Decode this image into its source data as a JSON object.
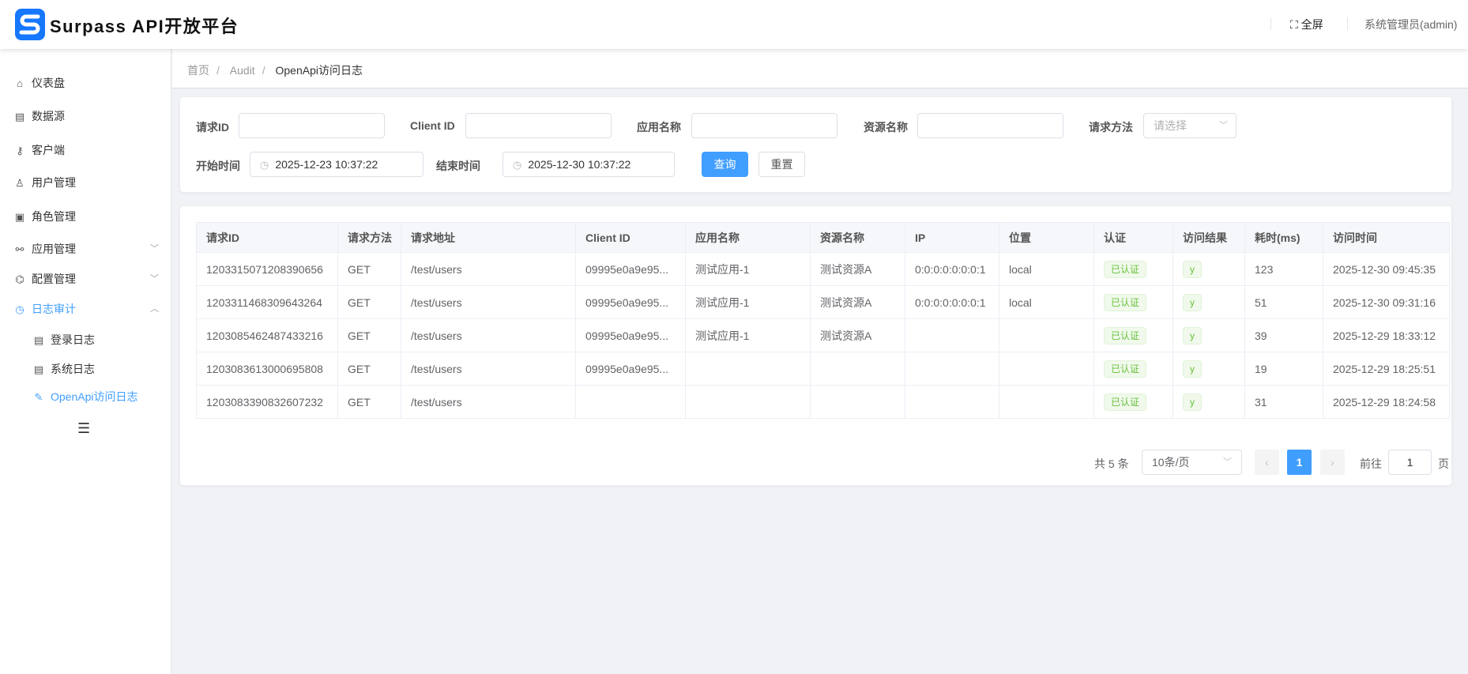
{
  "header": {
    "title": "Surpass API开放平台",
    "fullscreen_label": "全屏",
    "user_label": "系统管理员(admin)"
  },
  "sidebar": {
    "items": [
      {
        "label": "仪表盘",
        "icon": "home-icon",
        "glyph": "⌂"
      },
      {
        "label": "数据源",
        "icon": "database-icon",
        "glyph": "▤"
      },
      {
        "label": "客户端",
        "icon": "key-icon",
        "glyph": "⚷"
      },
      {
        "label": "用户管理",
        "icon": "user-icon",
        "glyph": "♙"
      },
      {
        "label": "角色管理",
        "icon": "role-icon",
        "glyph": "▣"
      },
      {
        "label": "应用管理",
        "icon": "app-icon",
        "glyph": "⚯",
        "chevron": "﹀"
      },
      {
        "label": "配置管理",
        "icon": "settings-icon",
        "glyph": "⌬",
        "chevron": "﹀"
      },
      {
        "label": "日志审计",
        "icon": "clock-icon",
        "glyph": "◷",
        "chevron": "︿",
        "active": true
      }
    ],
    "sub_items": [
      {
        "label": "登录日志",
        "icon": "log-icon",
        "glyph": "▤"
      },
      {
        "label": "系统日志",
        "icon": "log-icon",
        "glyph": "▤"
      },
      {
        "label": "OpenApi访问日志",
        "icon": "edit-icon",
        "glyph": "✎",
        "active": true
      }
    ]
  },
  "breadcrumb": [
    "首页",
    "Audit",
    "OpenApi访问日志"
  ],
  "filters": {
    "request_id_label": "请求ID",
    "request_id_value": "",
    "client_id_label": "Client ID",
    "client_id_value": "",
    "app_name_label": "应用名称",
    "app_name_value": "",
    "resource_name_label": "资源名称",
    "resource_name_value": "",
    "method_label": "请求方法",
    "method_placeholder": "请选择",
    "start_label": "开始时间",
    "start_value": "2025-12-23 10:37:22",
    "end_label": "结束时间",
    "end_value": "2025-12-30 10:37:22",
    "search_label": "查询",
    "reset_label": "重置"
  },
  "table": {
    "columns": [
      "请求ID",
      "请求方法",
      "请求地址",
      "Client ID",
      "应用名称",
      "资源名称",
      "IP",
      "位置",
      "认证",
      "访问结果",
      "耗时(ms)",
      "访问时间"
    ],
    "rows": [
      [
        "1203315071208390656",
        "GET",
        "/test/users",
        "09995e0a9e95...",
        "测试应用-1",
        "测试资源A",
        "0:0:0:0:0:0:0:1",
        "local",
        "已认证",
        "y",
        "123",
        "2025-12-30 09:45:35"
      ],
      [
        "1203311468309643264",
        "GET",
        "/test/users",
        "09995e0a9e95...",
        "测试应用-1",
        "测试资源A",
        "0:0:0:0:0:0:0:1",
        "local",
        "已认证",
        "y",
        "51",
        "2025-12-30 09:31:16"
      ],
      [
        "1203085462487433216",
        "GET",
        "/test/users",
        "09995e0a9e95...",
        "测试应用-1",
        "测试资源A",
        "",
        "",
        "已认证",
        "y",
        "39",
        "2025-12-29 18:33:12"
      ],
      [
        "1203083613000695808",
        "GET",
        "/test/users",
        "09995e0a9e95...",
        "",
        "",
        "",
        "",
        "已认证",
        "y",
        "19",
        "2025-12-29 18:25:51"
      ],
      [
        "1203083390832607232",
        "GET",
        "/test/users",
        "",
        "",
        "",
        "",
        "",
        "已认证",
        "y",
        "31",
        "2025-12-29 18:24:58"
      ]
    ]
  },
  "pagination": {
    "total_label": "共 5 条",
    "page_size": "10条/页",
    "current_page": "1",
    "goto_label": "前往",
    "goto_value": "1",
    "page_suffix": "页",
    "prev": "‹",
    "next": "›"
  }
}
